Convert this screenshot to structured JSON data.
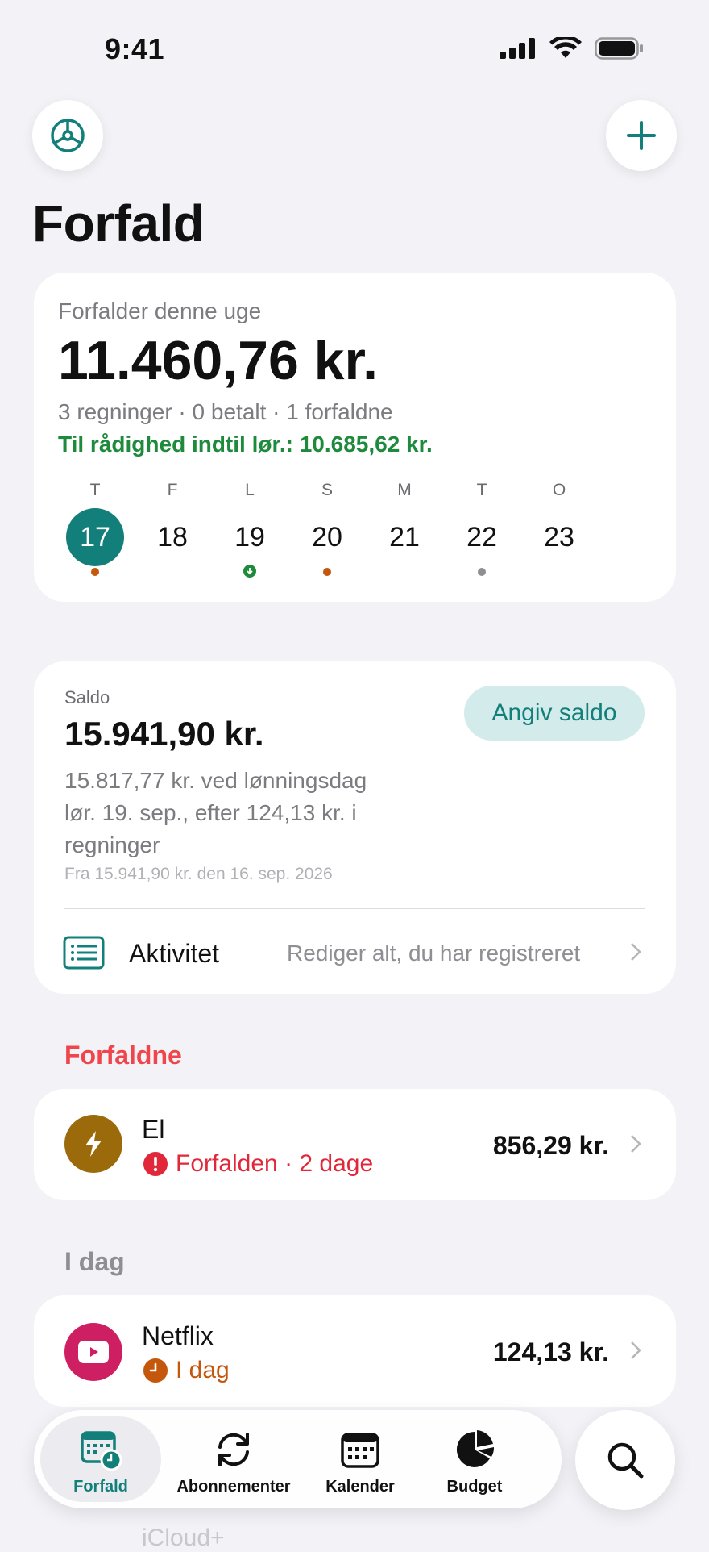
{
  "status": {
    "time": "9:41"
  },
  "header": {
    "title": "Forfald"
  },
  "week_card": {
    "caption": "Forfalder denne uge",
    "amount": "11.460,76 kr.",
    "summary": "3 regninger · 0 betalt · 1 forfaldne",
    "available": "Til rådighed indtil lør.: 10.685,62 kr.",
    "days": [
      {
        "letter": "T",
        "num": "17",
        "selected": true,
        "dot": "orange"
      },
      {
        "letter": "F",
        "num": "18",
        "selected": false,
        "dot": ""
      },
      {
        "letter": "L",
        "num": "19",
        "selected": false,
        "dot": "green-arrow"
      },
      {
        "letter": "S",
        "num": "20",
        "selected": false,
        "dot": "orange"
      },
      {
        "letter": "M",
        "num": "21",
        "selected": false,
        "dot": ""
      },
      {
        "letter": "T",
        "num": "22",
        "selected": false,
        "dot": "gray"
      },
      {
        "letter": "O",
        "num": "23",
        "selected": false,
        "dot": ""
      }
    ]
  },
  "balance_card": {
    "label": "Saldo",
    "amount": "15.941,90 kr.",
    "set_button": "Angiv saldo",
    "line1": "15.817,77 kr. ved lønningsdag",
    "line2": "lør. 19. sep., efter 124,13 kr. i",
    "line3": "regninger",
    "source": "Fra 15.941,90 kr. den 16. sep. 2026",
    "activity_label": "Aktivitet",
    "activity_hint": "Rediger alt, du har registreret"
  },
  "sections": {
    "overdue": {
      "title": "Forfaldne",
      "item": {
        "name": "El",
        "status": "Forfalden · 2 dage",
        "amount": "856,29 kr."
      }
    },
    "today": {
      "title": "I dag",
      "item": {
        "name": "Netflix",
        "status": "I dag",
        "amount": "124,13 kr."
      }
    },
    "peek": {
      "text": "iCloud+"
    }
  },
  "tabs": [
    {
      "label": "Forfald",
      "icon": "calendar-clock-icon",
      "active": true
    },
    {
      "label": "Abonnementer",
      "icon": "sync-icon",
      "active": false
    },
    {
      "label": "Kalender",
      "icon": "calendar-icon",
      "active": false
    },
    {
      "label": "Budget",
      "icon": "pie-chart-icon",
      "active": false
    }
  ],
  "colors": {
    "accent": "#137f7a",
    "available_green": "#1e8a3c",
    "overdue_red": "#e0283a",
    "today_orange": "#c4570c",
    "el_brown": "#9b6a0b",
    "netflix_pink": "#cf1f63"
  }
}
